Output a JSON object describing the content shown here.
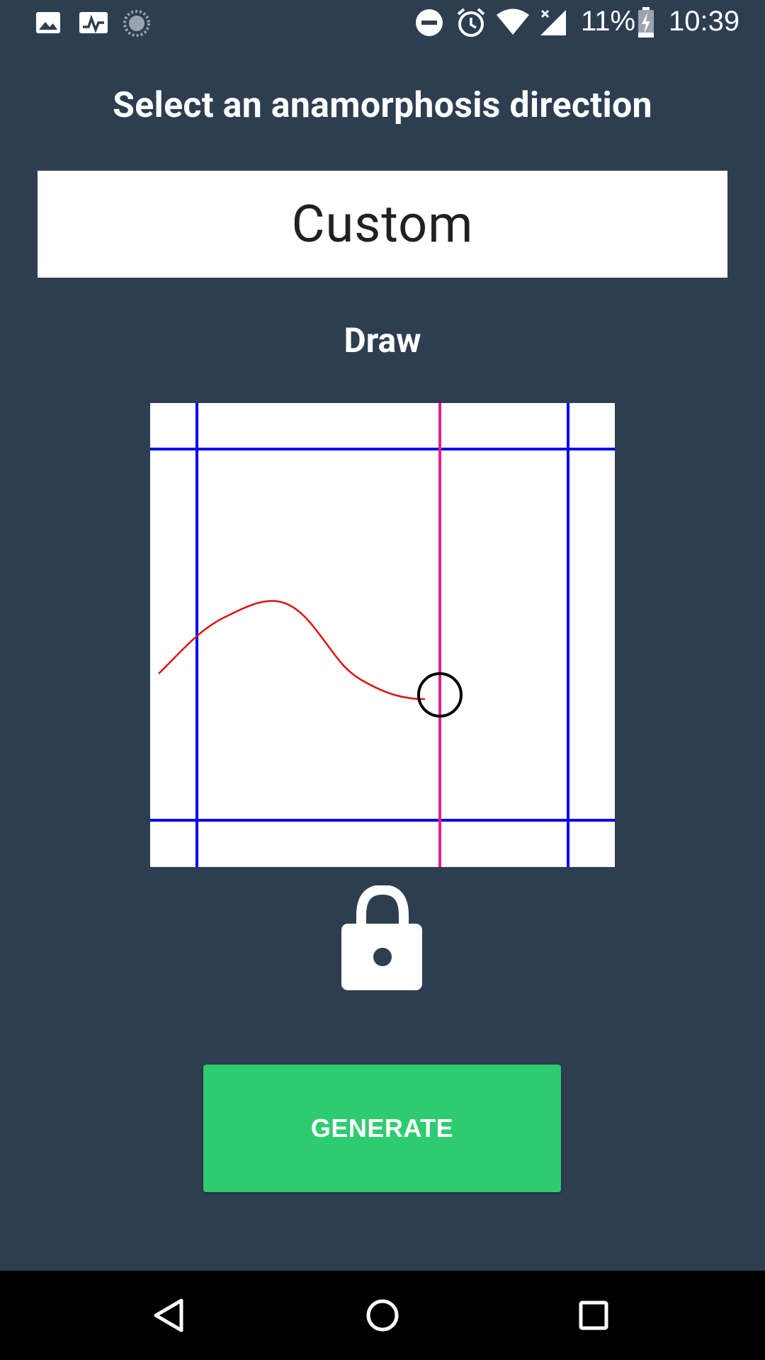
{
  "status_bar": {
    "time": "10:39",
    "battery_percent": "11%",
    "icons_left": [
      "image-icon",
      "activity-icon",
      "sync-icon"
    ],
    "icons_right": [
      "do-not-disturb-icon",
      "alarm-icon",
      "wifi-icon",
      "signal-icon",
      "battery-charging-icon"
    ]
  },
  "page": {
    "title": "Select an anamorphosis direction",
    "direction_value": "Custom",
    "draw_label": "Draw",
    "generate_label": "GENERATE"
  },
  "canvas": {
    "guide_color": "#0000ee",
    "cursor_line_color": "#e91e8c",
    "stroke_color": "#e01010",
    "handle_color": "#000000"
  },
  "lock": {
    "state": "unlocked",
    "icon": "unlocked-padlock-icon"
  },
  "nav_bar": {
    "buttons": [
      "back-icon",
      "home-icon",
      "recents-icon"
    ]
  },
  "colors": {
    "background": "#2e3e51",
    "accent": "#2ecc71"
  }
}
